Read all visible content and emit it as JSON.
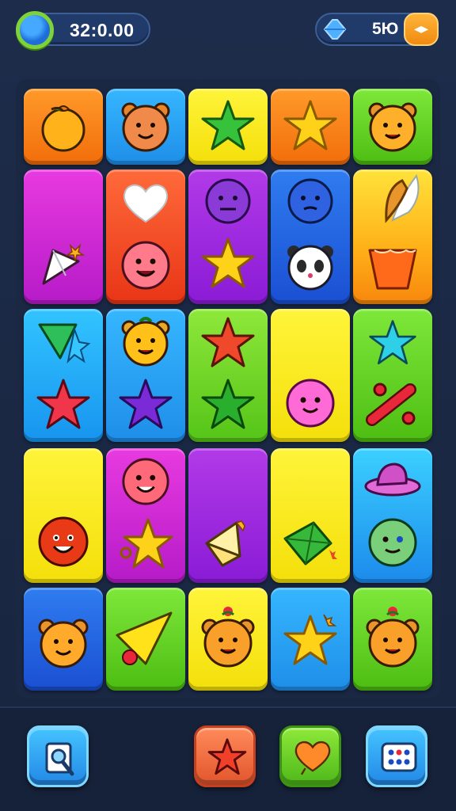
{
  "hud": {
    "coins": "32:0.00",
    "lives": "5Ю",
    "lives_button_glyph": "◂▸",
    "coin_icon": "blue-orb-coin-icon",
    "lives_icon": "blue-crystal-icon"
  },
  "board": {
    "tiles": [
      {
        "color": "orange",
        "icons": [
          "orange-fruit-icon"
        ]
      },
      {
        "color": "blue",
        "icons": [
          "orange-bear-face-icon"
        ]
      },
      {
        "color": "yellow",
        "icons": [
          "green-star-icon"
        ]
      },
      {
        "color": "orange",
        "icons": [
          "yellow-star-icon"
        ]
      },
      {
        "color": "green",
        "icons": [
          "orange-bear-face-icon"
        ]
      },
      {
        "color": "magenta",
        "icons": [
          "paper-kite-icon"
        ]
      },
      {
        "color": "red",
        "icons": [
          "white-heart-icon",
          "pink-smiley-face-icon"
        ]
      },
      {
        "color": "purple",
        "icons": [
          "purple-monster-face-icon",
          "yellow-star-icon"
        ]
      },
      {
        "color": "royal-blue",
        "icons": [
          "blue-monster-face-icon",
          "panda-face-icon"
        ]
      },
      {
        "color": "yellow-orange",
        "icons": [
          "leaf-icon",
          "orange-cup-icon"
        ]
      },
      {
        "color": "cyan",
        "icons": [
          "green-kite-icon",
          "red-star-icon"
        ]
      },
      {
        "color": "blue",
        "icons": [
          "yellow-bear-face-icon",
          "purple-star-icon"
        ]
      },
      {
        "color": "lime",
        "icons": [
          "red-star-icon",
          "green-star-icon"
        ]
      },
      {
        "color": "yellow",
        "icons": [
          "pink-smiley-face-icon"
        ]
      },
      {
        "color": "green",
        "icons": [
          "cyan-star-icon",
          "red-bone-icon"
        ]
      },
      {
        "color": "yellow",
        "icons": [
          "red-smiley-face-icon"
        ]
      },
      {
        "color": "magenta",
        "icons": [
          "pink-smiley-face-icon",
          "yellow-star-icon"
        ]
      },
      {
        "color": "purple",
        "icons": [
          "paper-kite-icon"
        ]
      },
      {
        "color": "yellow",
        "icons": [
          "green-kite-icon"
        ]
      },
      {
        "color": "cyan",
        "icons": [
          "pink-hat-icon",
          "green-smiley-face-icon"
        ]
      },
      {
        "color": "royal-blue",
        "icons": [
          "orange-bear-face-icon"
        ]
      },
      {
        "color": "green",
        "icons": [
          "yellow-pennant-icon"
        ]
      },
      {
        "color": "yellow",
        "icons": [
          "orange-bear-face-icon"
        ]
      },
      {
        "color": "blue",
        "icons": [
          "yellow-star-icon"
        ]
      },
      {
        "color": "green",
        "icons": [
          "orange-bear-face-icon"
        ]
      }
    ]
  },
  "footer": {
    "buttons": [
      {
        "name": "scan-button",
        "icon": "magnifier-card-icon"
      },
      {
        "name": "star-booster-button",
        "icon": "red-star-icon"
      },
      {
        "name": "heart-booster-button",
        "icon": "orange-heart-icon"
      },
      {
        "name": "grid-button",
        "icon": "dice-grid-icon"
      }
    ]
  },
  "colors": {
    "background": "#1b2a47",
    "coin_ring": "#7fd23a",
    "lives_button": "#f5a020"
  }
}
